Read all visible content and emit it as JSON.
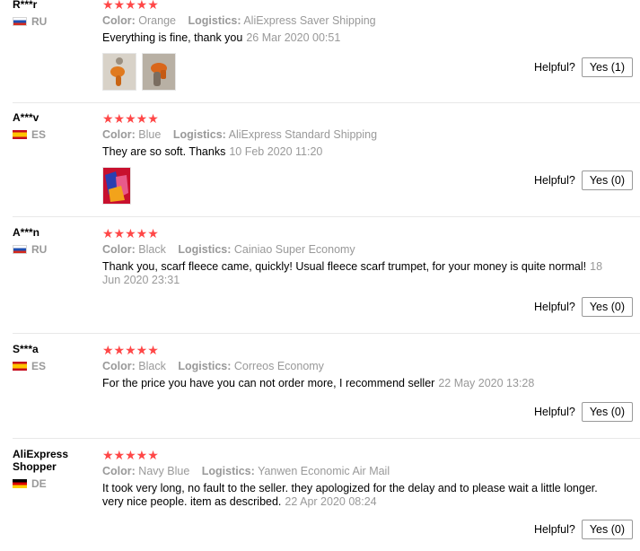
{
  "labels": {
    "color": "Color:",
    "logistics": "Logistics:",
    "helpful": "Helpful?",
    "stars": "★★★★★"
  },
  "reviews": [
    {
      "user": "R***r",
      "country": "RU",
      "flag": "ru",
      "rating": 5,
      "color": "Orange",
      "logistics": "AliExpress Saver Shipping",
      "text": "Everything is fine, thank you",
      "date": "26 Mar 2020 00:51",
      "photos": 2,
      "helpful_button": "Yes (1)"
    },
    {
      "user": "A***v",
      "country": "ES",
      "flag": "es",
      "rating": 5,
      "color": "Blue",
      "logistics": "AliExpress Standard Shipping",
      "text": "They are so soft. Thanks",
      "date": "10 Feb 2020 11:20",
      "photos": 1,
      "helpful_button": "Yes (0)"
    },
    {
      "user": "A***n",
      "country": "RU",
      "flag": "ru",
      "rating": 5,
      "color": "Black",
      "logistics": "Cainiao Super Economy",
      "text": "Thank you, scarf fleece came, quickly! Usual fleece scarf trumpet, for your money is quite normal!",
      "date": "18 Jun 2020 23:31",
      "photos": 0,
      "helpful_button": "Yes (0)"
    },
    {
      "user": "S***a",
      "country": "ES",
      "flag": "es",
      "rating": 5,
      "color": "Black",
      "logistics": "Correos Economy",
      "text": "For the price you have you can not order more, I recommend seller",
      "date": "22 May 2020 13:28",
      "photos": 0,
      "helpful_button": "Yes (0)"
    },
    {
      "user": "AliExpress Shopper",
      "country": "DE",
      "flag": "de",
      "rating": 5,
      "color": "Navy Blue",
      "logistics": "Yanwen Economic Air Mail",
      "text": "It took very long, no fault to the seller. they apologized for the delay and to please wait a little longer. very nice people. item as described.",
      "date": "22 Apr 2020 08:24",
      "photos": 0,
      "helpful_button": "Yes (0)"
    }
  ]
}
